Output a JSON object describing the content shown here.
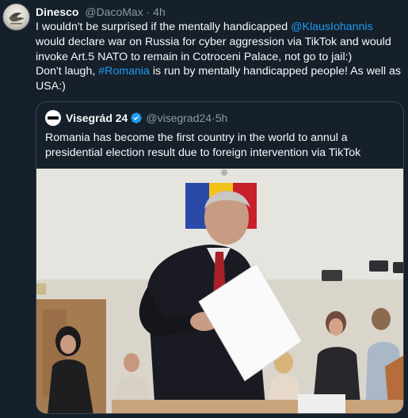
{
  "tweet": {
    "author_name": "Dinesco",
    "author_handle": "@DacoMax",
    "separator": "·",
    "time": "4h",
    "text_part1": "I wouldn't be surprised if the mentally handicapped ",
    "mention": "@KlausIohannis",
    "text_part2": " would declare war on Russia for cyber aggression via TikTok and would invoke Art.5 NATO to remain in Cotroceni Palace, not go to jail:)",
    "text_part3": "Don't laugh, ",
    "hashtag": "#Romania",
    "text_part4": " is run by mentally handicapped people! As well as USA:)"
  },
  "quote": {
    "author_name": "Visegrád 24",
    "author_handle": "@visegrad24",
    "separator": "·",
    "time": "5h",
    "text": "Romania has become the first country in the world to annul a presidential election result due to foreign intervention via TikTok"
  },
  "colors": {
    "background": "#15202b",
    "link": "#1d9bf0",
    "muted": "#8b98a5",
    "verified": "#1d9bf0",
    "border": "#38444d"
  },
  "icons": {
    "verified": "verified-badge-icon"
  }
}
